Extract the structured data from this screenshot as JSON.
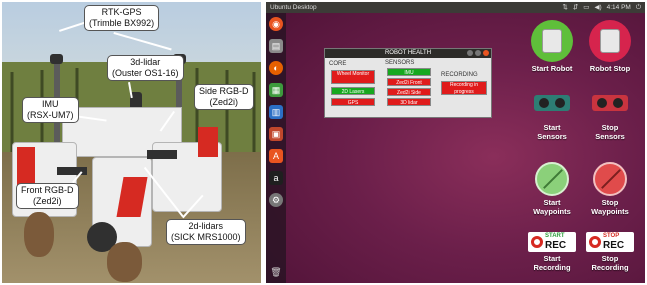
{
  "photo": {
    "callouts": [
      {
        "lines": [
          "RTK-GPS",
          "(Trimble BX992)"
        ]
      },
      {
        "lines": [
          "3d-lidar",
          "(Ouster OS1-16)"
        ]
      },
      {
        "lines": [
          "Side RGB-D",
          "(Zed2i)"
        ]
      },
      {
        "lines": [
          "IMU",
          "(RSX-UM7)"
        ]
      },
      {
        "lines": [
          "Front RGB-D",
          "(Zed2i)"
        ]
      },
      {
        "lines": [
          "2d-lidars",
          "(SICK MRS1000)"
        ]
      }
    ]
  },
  "desktop": {
    "title": "Ubuntu Desktop",
    "clock": "4:14 PM",
    "health_window": {
      "title": "ROBOT HEALTH",
      "core_label": "CORE",
      "sensors_label": "SENSORS",
      "recording_label": "RECORDING",
      "core_items": [
        {
          "label": "Wheel Monitor",
          "state": "err"
        },
        {
          "label": "2D Lasers",
          "state": "ok"
        },
        {
          "label": "GPS",
          "state": "err"
        }
      ],
      "sensor_items": [
        {
          "label": "IMU",
          "state": "ok"
        },
        {
          "label": "Zed2i Front",
          "state": "err"
        },
        {
          "label": "Zed2i Side",
          "state": "err"
        },
        {
          "label": "3D lidar",
          "state": "err"
        }
      ],
      "recording_items": [
        {
          "label": "Recording in progress",
          "state": "err"
        }
      ],
      "colors": {
        "ok": "#17a81f",
        "err": "#e01b1b"
      }
    },
    "buttons": {
      "start_robot": "Start Robot",
      "robot_stop": "Robot Stop",
      "start_sensors_1": "Start",
      "start_sensors_2": "Sensors",
      "stop_sensors_1": "Stop",
      "stop_sensors_2": "Sensors",
      "start_waypoints_1": "Start",
      "start_waypoints_2": "Waypoints",
      "stop_waypoints_1": "Stop",
      "stop_waypoints_2": "Waypoints",
      "start_recording_1": "Start",
      "start_recording_2": "Recording",
      "stop_recording_1": "Stop",
      "stop_recording_2": "Recording",
      "rec_start_top": "START",
      "rec_stop_top": "STOP",
      "rec_word": "REC"
    }
  }
}
